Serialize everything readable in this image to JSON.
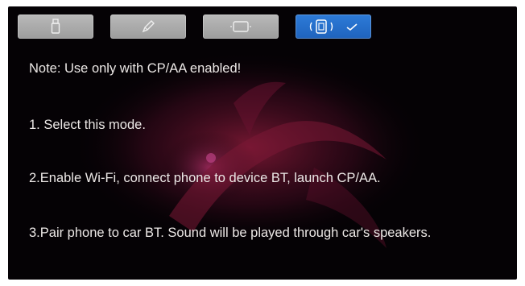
{
  "mode_bar": {
    "buttons": [
      {
        "icon": "usb-stick-icon",
        "active": false
      },
      {
        "icon": "pen-icon",
        "active": false
      },
      {
        "icon": "screen-frame-icon",
        "active": false
      },
      {
        "icon": "phone-bluetooth-icon",
        "active": true,
        "status_icon": "check-icon"
      }
    ],
    "active_color": "#2a74d2",
    "inactive_color": "#aaaaaa"
  },
  "instructions": {
    "note": "Note: Use only with CP/AA enabled!",
    "step1": "1. Select this mode.",
    "step2": "2.Enable Wi-Fi, connect phone to device BT, launch CP/AA.",
    "step3": "3.Pair phone to car BT. Sound will be played through car's speakers."
  }
}
